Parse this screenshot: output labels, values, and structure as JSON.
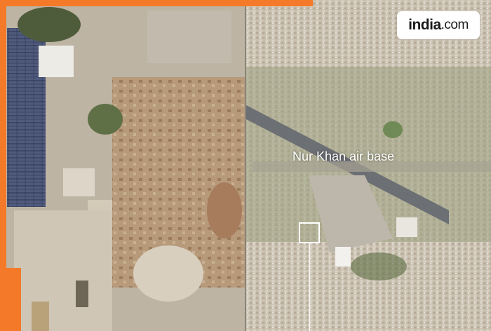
{
  "logo": {
    "name": "india",
    "suffix": ".com"
  },
  "map_label": "Nur Khan air base",
  "colors": {
    "accent": "#f47a2a",
    "label": "#ffffff"
  }
}
